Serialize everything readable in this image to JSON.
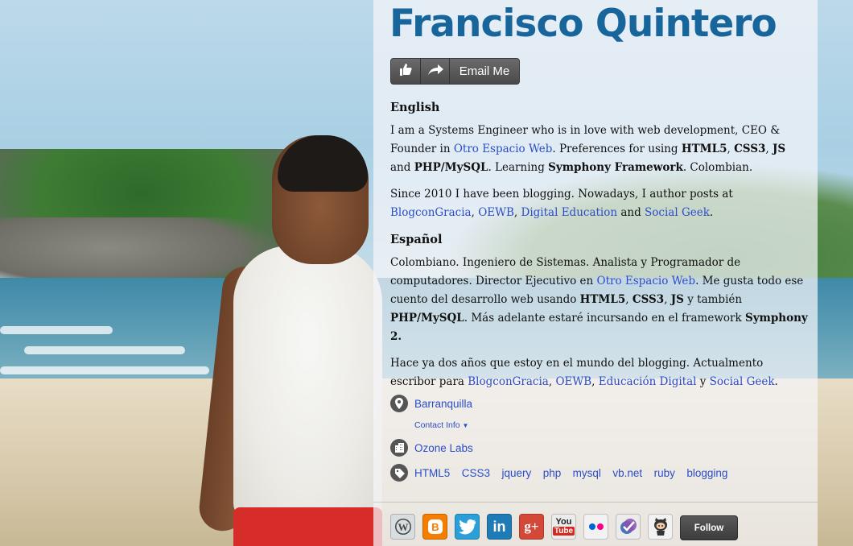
{
  "profile": {
    "name": "Francisco Quintero",
    "email_label": "Email Me"
  },
  "english": {
    "heading": "English",
    "p1": {
      "t1": "I am a Systems Engineer who is in love with web development, CEO & Founder in ",
      "link1": "Otro Espacio Web",
      "t2": ". Preferences for using ",
      "b1": "HTML5",
      "t3": ", ",
      "b2": "CSS3",
      "t4": ", ",
      "b3": "JS",
      "t5": " and ",
      "b4": "PHP/MySQL",
      "t6": ". Learning ",
      "b5": "Symphony Framework",
      "t7": ". Colombian."
    },
    "p2": {
      "t1": "Since 2010 I have been blogging. Nowadays, I author posts at ",
      "link1": "BlogconGracia",
      "t2": ", ",
      "link2": "OEWB",
      "t3": ", ",
      "link3": "Digital Education",
      "t4": " and ",
      "link4": "Social Geek",
      "t5": "."
    }
  },
  "spanish": {
    "heading": "Español",
    "p1": {
      "t1": "Colombiano. Ingeniero de Sistemas. Analista y Programador de computadores. Director Ejecutivo en ",
      "link1": "Otro Espacio Web",
      "t2": ". Me gusta todo ese cuento del desarrollo web usando ",
      "b1": "HTML5",
      "t3": ", ",
      "b2": "CSS3",
      "t4": ", ",
      "b3": "JS",
      "t5": " y también ",
      "b4": "PHP/MySQL",
      "t6": ". Más adelante estaré incursando en el framework ",
      "b5": "Symphony 2."
    },
    "p2": {
      "t1": "Hace ya dos años que estoy en el mundo del blogging. Actualmento escribor para ",
      "link1": "BlogconGracia",
      "t2": ", ",
      "link2": "OEWB",
      "t3": ", ",
      "link3": "Educación Digital",
      "t4": " y ",
      "link4": "Social Geek",
      "t5": "."
    }
  },
  "meta": {
    "location": "Barranquilla",
    "contact_info": "Contact Info",
    "company": "Ozone Labs",
    "tags": [
      "HTML5",
      "CSS3",
      "jquery",
      "php",
      "mysql",
      "vb.net",
      "ruby",
      "blogging"
    ]
  },
  "social": {
    "icons": [
      "wordpress-icon",
      "blogger-icon",
      "twitter-icon",
      "linkedin-icon",
      "google-plus-icon",
      "youtube-icon",
      "flickr-icon",
      "foursquare-icon",
      "github-icon"
    ],
    "labels": {
      "wordpress": "W",
      "blogger": "B",
      "twitter": "t",
      "linkedin": "in",
      "googleplus": "g+",
      "youtube_top": "You",
      "youtube_bottom": "Tube"
    },
    "colors": {
      "wordpress": "#d8dde0",
      "blogger": "#f57d00",
      "twitter": "#2a9fd8",
      "linkedin": "#1f7bb6",
      "googleplus": "#d34836",
      "youtube": "#ececec",
      "flickr": "#f2f2f2",
      "foursquare": "#ececec",
      "github": "#f2f2f2"
    },
    "follow_label": "Follow"
  },
  "colors": {
    "name": "#17659a",
    "link": "#2a4ec8"
  }
}
